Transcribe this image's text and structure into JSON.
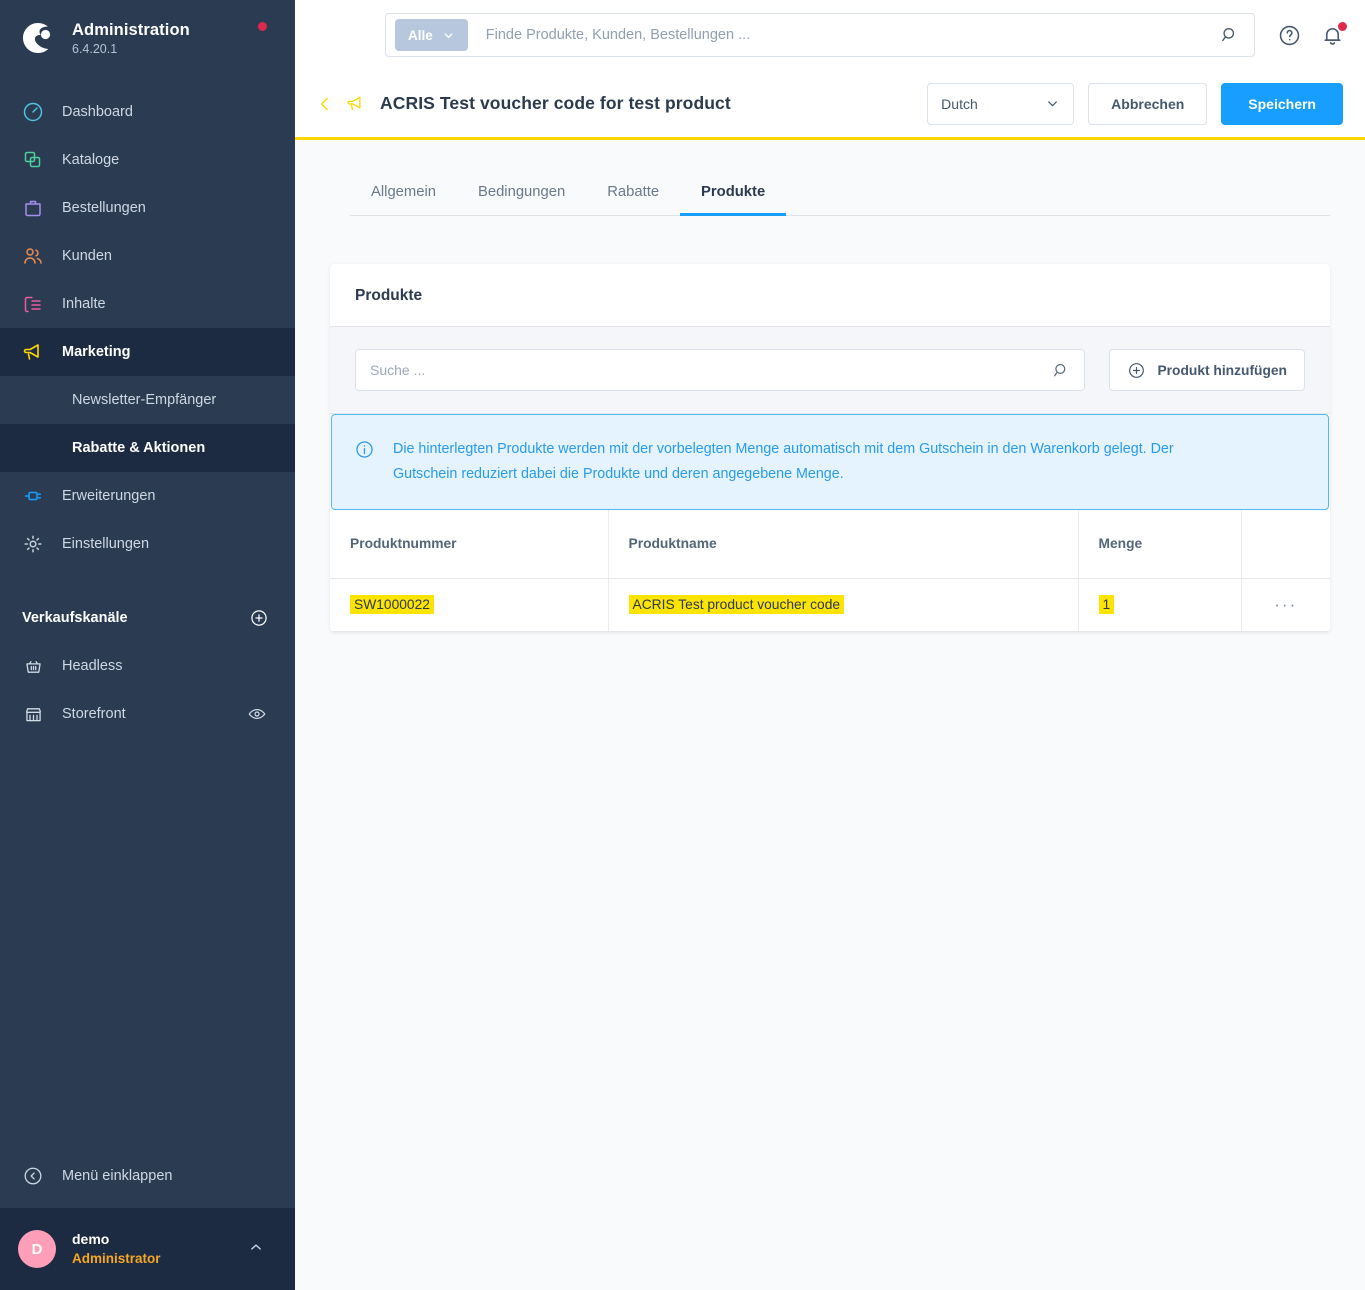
{
  "sidebar": {
    "brand": {
      "title": "Administration",
      "version": "6.4.20.1",
      "logo_icon": "shopware-logo-icon",
      "status_dot_color": "#de294c"
    },
    "items": [
      {
        "label": "Dashboard",
        "icon": "dashboard-gauge-icon",
        "color": "#4fc3e0"
      },
      {
        "label": "Kataloge",
        "icon": "catalog-copy-icon",
        "color": "#4fd09b"
      },
      {
        "label": "Bestellungen",
        "icon": "orders-bag-icon",
        "color": "#a58ef0"
      },
      {
        "label": "Kunden",
        "icon": "customers-people-icon",
        "color": "#f08b4f"
      },
      {
        "label": "Inhalte",
        "icon": "content-list-icon",
        "color": "#f05b9e"
      },
      {
        "label": "Marketing",
        "icon": "marketing-megaphone-icon",
        "color": "#ffd700"
      }
    ],
    "sub_items": [
      {
        "label": "Newsletter-Empfänger"
      },
      {
        "label": "Rabatte & Aktionen"
      }
    ],
    "items_after": [
      {
        "label": "Erweiterungen",
        "icon": "extensions-plug-icon",
        "color": "#189eff"
      },
      {
        "label": "Einstellungen",
        "icon": "settings-gear-icon",
        "color": "#c8d2de"
      }
    ],
    "section_label": "Verkaufskanäle",
    "section_add_icon": "plus-circle-icon",
    "channels": [
      {
        "label": "Headless",
        "icon": "basket-icon",
        "trailing_icon": ""
      },
      {
        "label": "Storefront",
        "icon": "storefront-icon",
        "trailing_icon": "eye-icon"
      }
    ],
    "collapse_label": "Menü einklappen",
    "collapse_icon": "chevron-left-circle-icon",
    "user": {
      "initial": "D",
      "name": "demo",
      "role": "Administrator",
      "caret_icon": "chevron-up-icon"
    }
  },
  "topbar": {
    "scope_label": "Alle",
    "scope_caret_icon": "chevron-down-icon",
    "search_placeholder": "Finde Produkte, Kunden, Bestellungen ...",
    "search_value": "",
    "search_icon": "search-icon",
    "help_icon": "help-circle-icon",
    "notification_icon": "bell-icon",
    "notification_dot_color": "#de294c"
  },
  "pagehead": {
    "back_icon": "chevron-left-icon",
    "entity_icon": "marketing-megaphone-icon",
    "title": "ACRIS Test voucher code for test product",
    "language": "Dutch",
    "language_caret_icon": "chevron-down-icon",
    "cancel_label": "Abbrechen",
    "save_label": "Speichern",
    "accent_underline_color": "#ffd700"
  },
  "tabs": [
    {
      "label": "Allgemein",
      "active": false
    },
    {
      "label": "Bedingungen",
      "active": false
    },
    {
      "label": "Rabatte",
      "active": false
    },
    {
      "label": "Produkte",
      "active": true
    }
  ],
  "card": {
    "title": "Produkte",
    "search_placeholder": "Suche ...",
    "search_value": "",
    "search_icon": "search-icon",
    "add_button_label": "Produkt hinzufügen",
    "add_button_icon": "plus-circle-icon",
    "alert": {
      "icon": "info-circle-icon",
      "text": "Die hinterlegten Produkte werden mit der vorbelegten Menge automatisch mit dem Gutschein in den Warenkorb gelegt. Der Gutschein reduziert dabei die Produkte und deren angegebene Menge."
    },
    "table": {
      "columns": [
        "Produktnummer",
        "Produktname",
        "Menge",
        ""
      ],
      "rows": [
        {
          "produktnummer": "SW1000022",
          "produktname": "ACRIS Test product voucher code",
          "menge": "1",
          "actions_icon": "ellipsis-icon",
          "actions_label": "···"
        }
      ],
      "highlight_color": "#ffe401"
    }
  }
}
